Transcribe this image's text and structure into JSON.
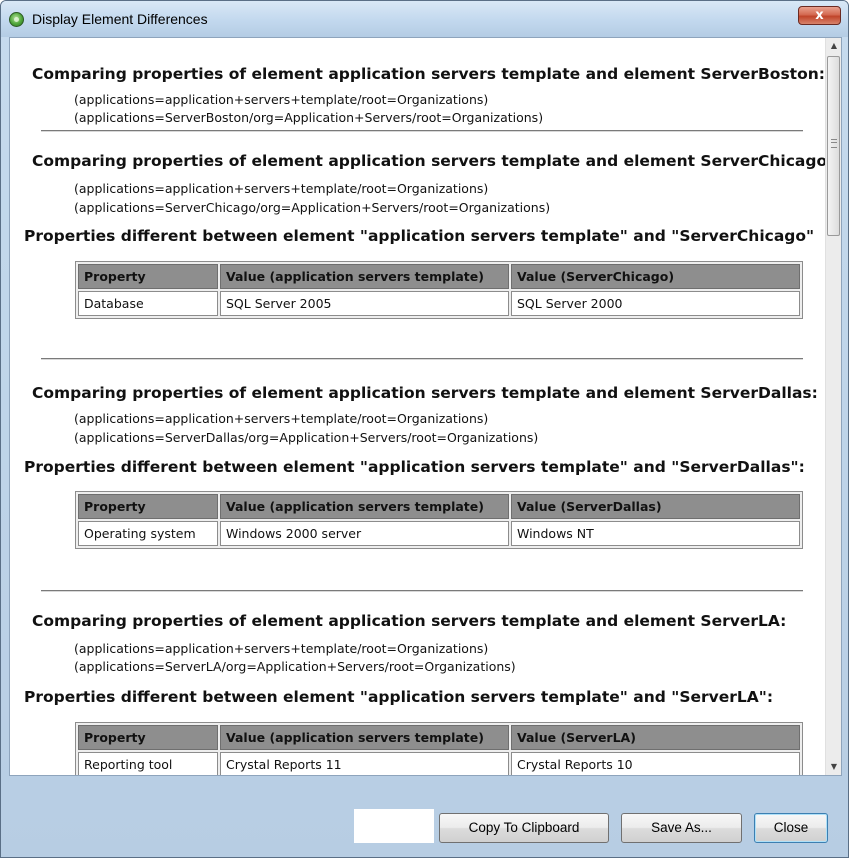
{
  "window": {
    "title": "Display Element Differences",
    "close_glyph": "x"
  },
  "sections": [
    {
      "heading": "Comparing properties of element application servers template and element ServerBoston:",
      "path1": "(applications=application+servers+template/root=Organizations)",
      "path2": "(applications=ServerBoston/org=Application+Servers/root=Organizations)"
    },
    {
      "heading": "Comparing properties of element application servers template and element ServerChicago:",
      "path1": "(applications=application+servers+template/root=Organizations)",
      "path2": "(applications=ServerChicago/org=Application+Servers/root=Organizations)",
      "diff_heading": "Properties different between element \"application servers template\" and \"ServerChicago\"",
      "table": {
        "headers": [
          "Property",
          "Value (application servers template)",
          "Value (ServerChicago)"
        ],
        "row": [
          "Database",
          "SQL Server 2005",
          "SQL Server 2000"
        ]
      }
    },
    {
      "heading": "Comparing properties of element application servers template and element ServerDallas:",
      "path1": "(applications=application+servers+template/root=Organizations)",
      "path2": "(applications=ServerDallas/org=Application+Servers/root=Organizations)",
      "diff_heading": "Properties different between element \"application servers template\" and \"ServerDallas\":",
      "table": {
        "headers": [
          "Property",
          "Value (application servers template)",
          "Value (ServerDallas)"
        ],
        "row": [
          "Operating system",
          "Windows 2000 server",
          "Windows NT"
        ]
      }
    },
    {
      "heading": "Comparing properties of element application servers template and element ServerLA:",
      "path1": "(applications=application+servers+template/root=Organizations)",
      "path2": "(applications=ServerLA/org=Application+Servers/root=Organizations)",
      "diff_heading": "Properties different between element \"application servers template\" and \"ServerLA\":",
      "table": {
        "headers": [
          "Property",
          "Value (application servers template)",
          "Value (ServerLA)"
        ],
        "row": [
          "Reporting tool",
          "Crystal Reports 11",
          "Crystal Reports 10"
        ]
      }
    }
  ],
  "buttons": {
    "copy": "Copy To Clipboard",
    "save_as": "Save As...",
    "close": "Close"
  },
  "icons": {
    "app": "green-globe-icon",
    "scroll_up": "chevron-up-icon",
    "scroll_down": "chevron-down-icon"
  }
}
